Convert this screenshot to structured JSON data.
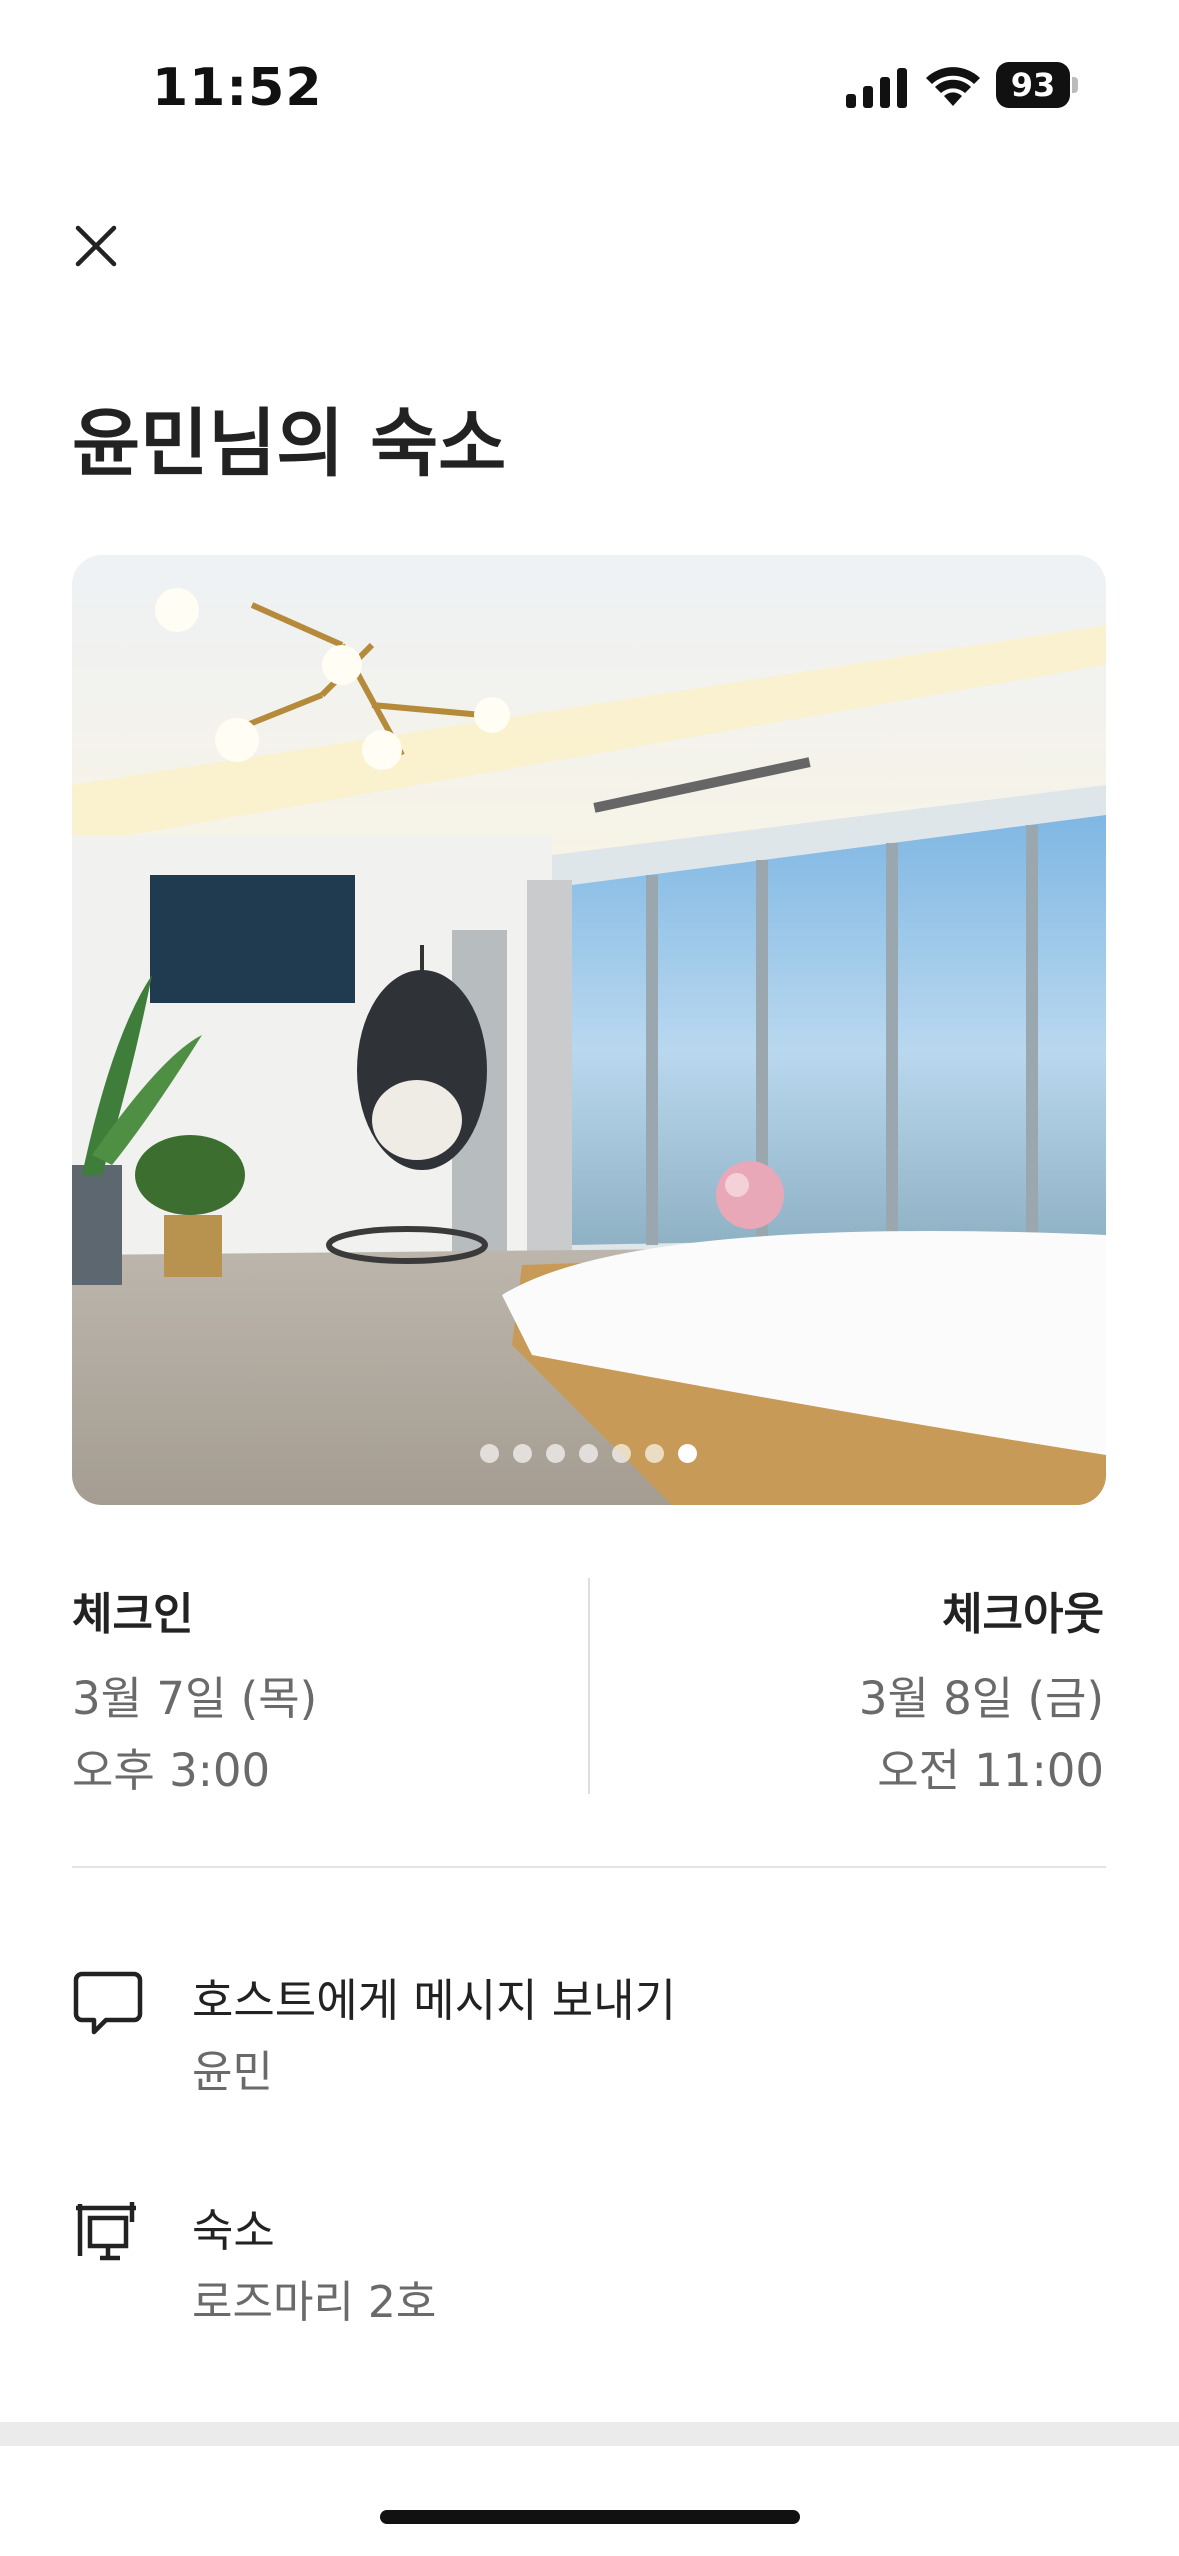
{
  "status_bar": {
    "time": "11:52",
    "battery": "93"
  },
  "header": {
    "close_icon": "close-icon"
  },
  "listing": {
    "title": "윤민님의 숙소"
  },
  "photo": {
    "description_icon": "room-photo",
    "dot_count": 7,
    "active_dot": 6
  },
  "checkin": {
    "label": "체크인",
    "date": "3월 7일 (목)",
    "time": "오후 3:00"
  },
  "checkout": {
    "label": "체크아웃",
    "date": "3월 8일 (금)",
    "time": "오전 11:00"
  },
  "rows": [
    {
      "icon": "message-icon",
      "title": "호스트에게 메시지 보내기",
      "subtitle": "윤민"
    },
    {
      "icon": "house-icon",
      "title": "숙소",
      "subtitle": "로즈마리 2호"
    }
  ],
  "colors": {
    "text_primary": "#222222",
    "text_secondary": "#6a6a6a",
    "divider": "#dddddd"
  }
}
